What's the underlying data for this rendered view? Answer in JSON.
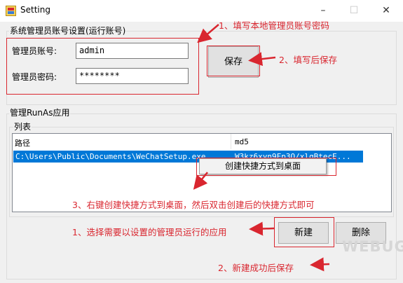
{
  "window": {
    "title": "Setting",
    "controls": [
      "–",
      "☐",
      "✕"
    ]
  },
  "admin_group": {
    "title": "系统管理员账号设置(运行账号)",
    "account_label": "管理员账号:",
    "account_value": "admin",
    "password_label": "管理员密码:",
    "password_value": "********",
    "save_label": "保存"
  },
  "runas_group": {
    "title": "管理RunAs应用",
    "list_title": "列表",
    "columns": [
      "路径",
      "md5"
    ],
    "rows": [
      {
        "path": "C:\\Users\\Public\\Documents\\WeChatSetup.exe",
        "md5": "W3kz6xyn9Fp3Q/xlqBtecE..."
      }
    ],
    "context_menu_item": "创建快捷方式到桌面",
    "new_label": "新建",
    "delete_label": "删除"
  },
  "annotations": {
    "a1": "1、填写本地管理员账号密码",
    "a2": "2、填写后保存",
    "a3": "3、右键创建快捷方式到桌面，然后双击创建后的快捷方式即可",
    "a4": "1、选择需要以设置的管理员运行的应用",
    "a5": "2、新建成功后保存"
  },
  "watermark": "WEBUG",
  "colors": {
    "annotation_red": "#d9262f",
    "selection_blue": "#0078d7",
    "window_bg": "#f0f0f0"
  }
}
